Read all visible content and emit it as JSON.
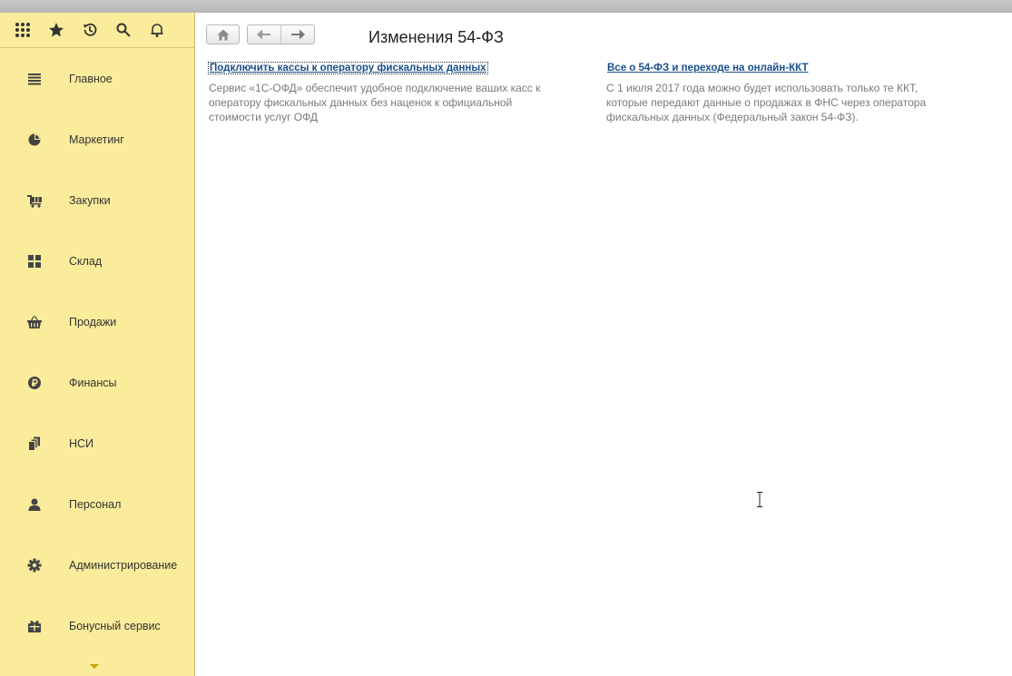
{
  "toolbar": {
    "icons": [
      "apps-grid-icon",
      "favorites-star-icon",
      "history-icon",
      "search-icon",
      "notifications-bell-icon"
    ]
  },
  "sidebar": {
    "items": [
      {
        "label": "Главное",
        "icon": "menu-lines-icon"
      },
      {
        "label": "Маркетинг",
        "icon": "pie-chart-icon"
      },
      {
        "label": "Закупки",
        "icon": "cart-icon"
      },
      {
        "label": "Склад",
        "icon": "warehouse-grid-icon"
      },
      {
        "label": "Продажи",
        "icon": "basket-icon"
      },
      {
        "label": "Финансы",
        "icon": "ruble-coin-icon"
      },
      {
        "label": "НСИ",
        "icon": "documents-icon"
      },
      {
        "label": "Персонал",
        "icon": "person-icon"
      },
      {
        "label": "Администрирование",
        "icon": "gear-icon"
      },
      {
        "label": "Бонусный сервис",
        "icon": "gift-icon"
      }
    ]
  },
  "main": {
    "title": "Изменения 54-ФЗ",
    "left": {
      "link": "Подключить кассы к оператору фискальных данных",
      "description": "Сервис «1С-ОФД» обеспечит удобное подключение ваших касс к оператору фискальных данных без наценок к официальной стоимости услуг ОФД"
    },
    "right": {
      "link": "Все о 54-ФЗ и переходе на онлайн-ККТ",
      "description": "С 1 июля 2017 года можно будет использовать только те ККТ, которые передают данные о продажах в ФНС через оператора фискальных данных (Федеральный закон 54-ФЗ)."
    }
  },
  "colors": {
    "sidebar_bg": "#fbec9b",
    "link": "#1b4f8a",
    "description_text": "#7a7a7a"
  }
}
